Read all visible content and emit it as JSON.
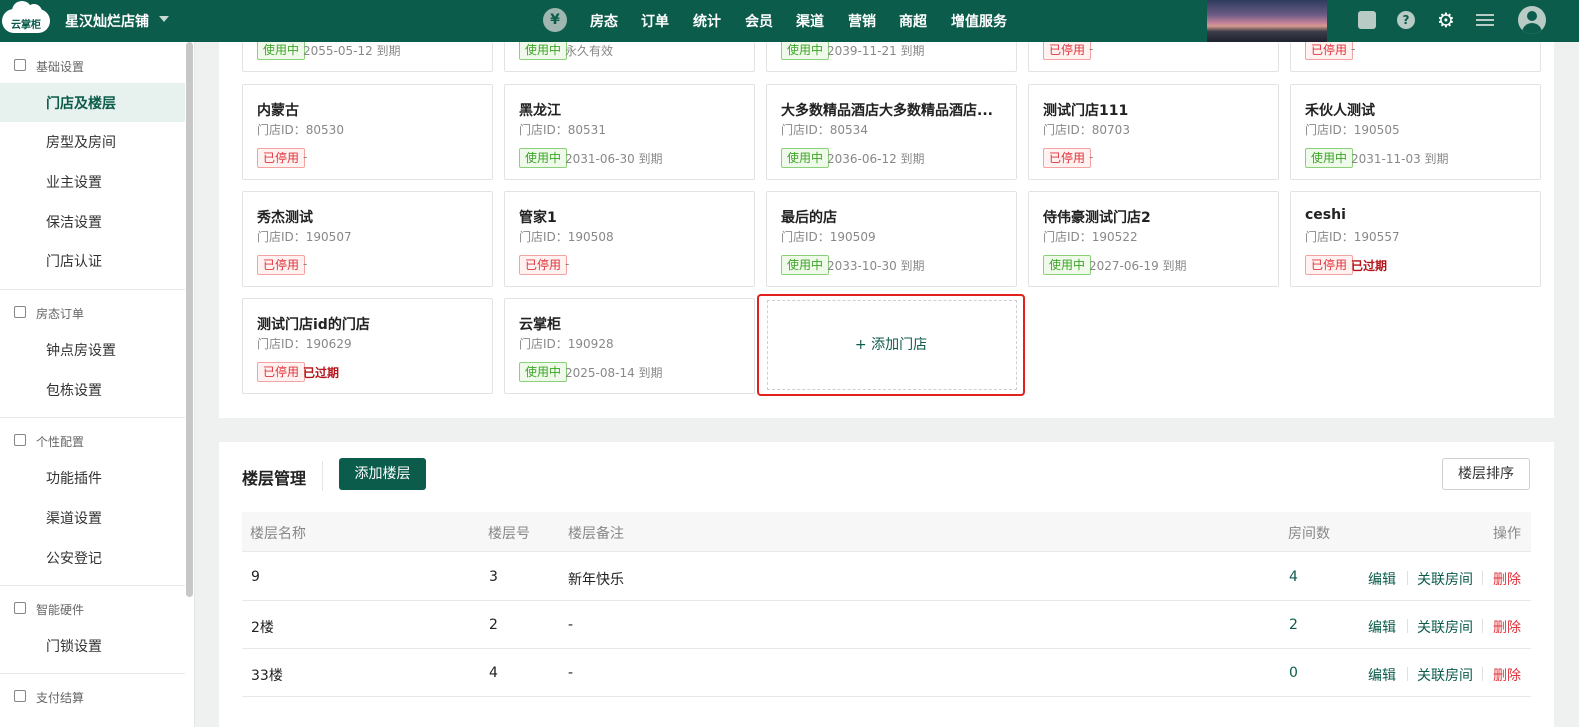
{
  "app": {
    "logo_text": "云掌柜",
    "store_name": "星汉灿烂店铺",
    "nav": [
      "房态",
      "订单",
      "统计",
      "会员",
      "渠道",
      "营销",
      "商超",
      "增值服务"
    ],
    "yen_symbol": "¥",
    "help_symbol": "?",
    "gear_symbol": "⚙"
  },
  "sidebar": {
    "groups": [
      {
        "label": "基础设置",
        "items": [
          "门店及楼层",
          "房型及房间",
          "业主设置",
          "保洁设置",
          "门店认证"
        ]
      },
      {
        "label": "房态订单",
        "items": [
          "钟点房设置",
          "包栋设置"
        ]
      },
      {
        "label": "个性配置",
        "items": [
          "功能插件",
          "渠道设置",
          "公安登记"
        ]
      },
      {
        "label": "智能硬件",
        "items": [
          "门锁设置"
        ]
      },
      {
        "label": "支付结算",
        "items": []
      }
    ],
    "active": "门店及楼层"
  },
  "status_labels": {
    "on": "使用中",
    "off": "已停用"
  },
  "store_id_prefix": "门店ID：",
  "stores": [
    {
      "name": "",
      "id": "",
      "status": "使用中",
      "expiry": "2055-05-12 到期"
    },
    {
      "name": "",
      "id": "",
      "status": "使用中",
      "expiry": "永久有效"
    },
    {
      "name": "",
      "id": "",
      "status": "使用中",
      "expiry": "2039-11-21 到期"
    },
    {
      "name": "",
      "id": "",
      "status": "已停用",
      "expiry": "-"
    },
    {
      "name": "",
      "id": "",
      "status": "已停用",
      "expiry": "-"
    },
    {
      "name": "内蒙古",
      "id": "门店ID：80530",
      "status": "已停用",
      "expiry": "-"
    },
    {
      "name": "黑龙江",
      "id": "门店ID：80531",
      "status": "使用中",
      "expiry": "2031-06-30 到期"
    },
    {
      "name": "大多数精品酒店大多数精品酒店...",
      "id": "门店ID：80534",
      "status": "使用中",
      "expiry": "2036-06-12 到期"
    },
    {
      "name": "测试门店111",
      "id": "门店ID：80703",
      "status": "已停用",
      "expiry": "-"
    },
    {
      "name": "禾伙人测试",
      "id": "门店ID：190505",
      "status": "使用中",
      "expiry": "2031-11-03 到期"
    },
    {
      "name": "秀杰测试",
      "id": "门店ID：190507",
      "status": "已停用",
      "expiry": "-"
    },
    {
      "name": "管家1",
      "id": "门店ID：190508",
      "status": "已停用",
      "expiry": "-"
    },
    {
      "name": "最后的店",
      "id": "门店ID：190509",
      "status": "使用中",
      "expiry": "2033-10-30 到期"
    },
    {
      "name": "侍伟豪测试门店2",
      "id": "门店ID：190522",
      "status": "使用中",
      "expiry": "2027-06-19 到期"
    },
    {
      "name": "ceshi",
      "id": "门店ID：190557",
      "status": "已停用",
      "expiry": "已过期"
    },
    {
      "name": "测试门店id的门店",
      "id": "门店ID：190629",
      "status": "已停用",
      "expiry": "已过期"
    },
    {
      "name": "云掌柜",
      "id": "门店ID：190928",
      "status": "使用中",
      "expiry": "2025-08-14 到期"
    }
  ],
  "add_store": {
    "label": "+ 添加门店"
  },
  "floors": {
    "title": "楼层管理",
    "add_button": "添加楼层",
    "sort_button": "楼层排序",
    "columns": {
      "name": "楼层名称",
      "number": "楼层号",
      "note": "楼层备注",
      "rooms": "房间数",
      "ops": "操作"
    },
    "rows": [
      {
        "name": "9",
        "number": "3",
        "note": "新年快乐",
        "rooms": "4"
      },
      {
        "name": "2楼",
        "number": "2",
        "note": "-",
        "rooms": "2"
      },
      {
        "name": "33楼",
        "number": "4",
        "note": "-",
        "rooms": "0"
      }
    ],
    "actions": {
      "edit": "编辑",
      "link": "关联房间",
      "delete": "删除"
    }
  },
  "colors": {
    "brand": "#0c5c4c",
    "danger": "#e0333a",
    "success": "#3aa526"
  }
}
